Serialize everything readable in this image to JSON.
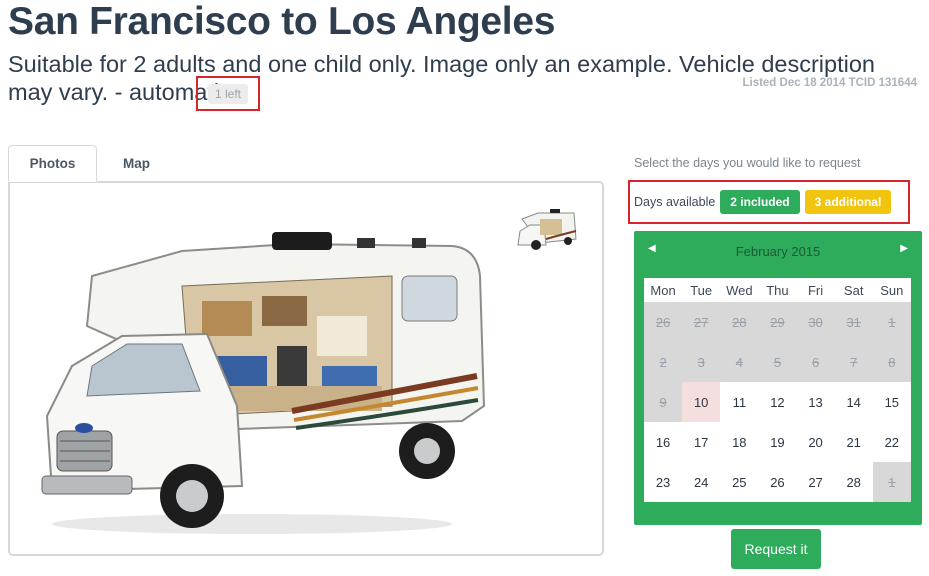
{
  "header": {
    "title": "San Francisco to Los Angeles",
    "subtitle": "Suitable for 2 adults and one child only. Image only an example. Vehicle description may vary. - automatic",
    "availability_badge": "1 left",
    "listed_info": "Listed Dec 18 2014 TCID 131644"
  },
  "tabs": [
    {
      "label": "Photos",
      "active": true
    },
    {
      "label": "Map",
      "active": false
    }
  ],
  "booking": {
    "hint": "Select the days you would like to request",
    "days_available_label": "Days available",
    "included_badge": "2 included",
    "additional_badge": "3 additional",
    "included_color": "#2eac5c",
    "additional_color": "#f1c40f",
    "request_button": "Request it"
  },
  "calendar": {
    "month_label": "February 2015",
    "prev_icon": "left-caret",
    "next_icon": "right-caret",
    "weekdays": [
      "Mon",
      "Tue",
      "Wed",
      "Thu",
      "Fri",
      "Sat",
      "Sun"
    ],
    "weeks": [
      [
        {
          "d": "26",
          "s": "disabled"
        },
        {
          "d": "27",
          "s": "disabled"
        },
        {
          "d": "28",
          "s": "disabled"
        },
        {
          "d": "29",
          "s": "disabled"
        },
        {
          "d": "30",
          "s": "disabled"
        },
        {
          "d": "31",
          "s": "disabled"
        },
        {
          "d": "1",
          "s": "disabled"
        }
      ],
      [
        {
          "d": "2",
          "s": "disabled"
        },
        {
          "d": "3",
          "s": "disabled"
        },
        {
          "d": "4",
          "s": "disabled"
        },
        {
          "d": "5",
          "s": "disabled"
        },
        {
          "d": "6",
          "s": "disabled"
        },
        {
          "d": "7",
          "s": "disabled"
        },
        {
          "d": "8",
          "s": "disabled"
        }
      ],
      [
        {
          "d": "9",
          "s": "disabled"
        },
        {
          "d": "10",
          "s": "today"
        },
        {
          "d": "11",
          "s": "available"
        },
        {
          "d": "12",
          "s": "available"
        },
        {
          "d": "13",
          "s": "available"
        },
        {
          "d": "14",
          "s": "available"
        },
        {
          "d": "15",
          "s": "available"
        }
      ],
      [
        {
          "d": "16",
          "s": "available"
        },
        {
          "d": "17",
          "s": "available"
        },
        {
          "d": "18",
          "s": "available"
        },
        {
          "d": "19",
          "s": "available"
        },
        {
          "d": "20",
          "s": "available"
        },
        {
          "d": "21",
          "s": "available"
        },
        {
          "d": "22",
          "s": "available"
        }
      ],
      [
        {
          "d": "23",
          "s": "available"
        },
        {
          "d": "24",
          "s": "available"
        },
        {
          "d": "25",
          "s": "available"
        },
        {
          "d": "26",
          "s": "available"
        },
        {
          "d": "27",
          "s": "available"
        },
        {
          "d": "28",
          "s": "available"
        },
        {
          "d": "1",
          "s": "disabled"
        }
      ]
    ]
  },
  "colors": {
    "title": "#2f3e4f",
    "calendar_green": "#2eac5c",
    "highlight_border": "#d9242c"
  }
}
